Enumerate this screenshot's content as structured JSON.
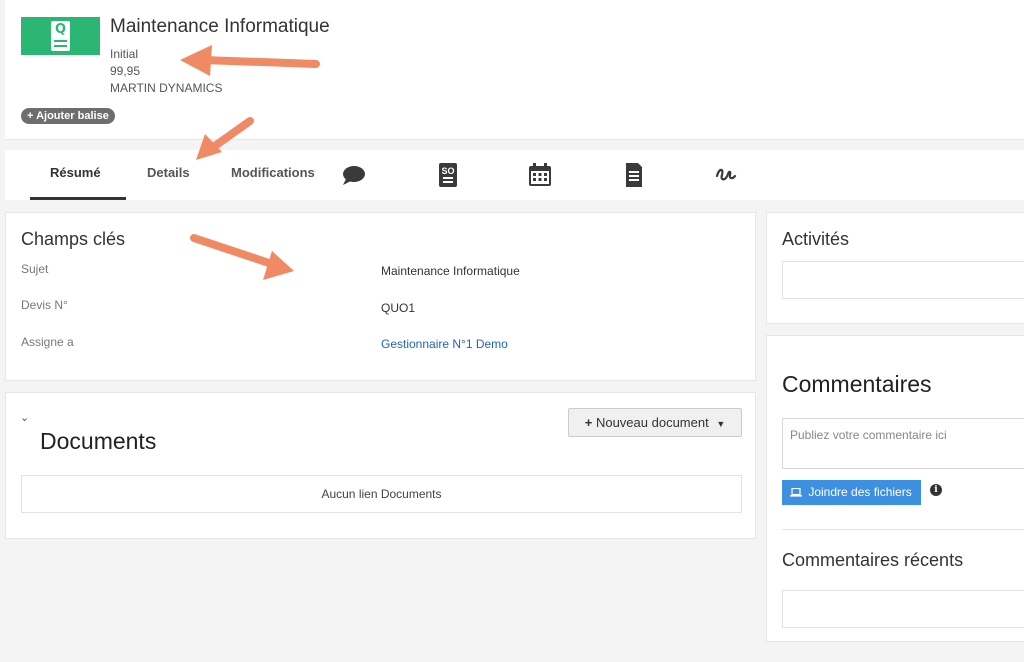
{
  "record": {
    "title": "Maintenance Informatique",
    "status": "Initial",
    "amount": "99,95",
    "company": "MARTIN DYNAMICS",
    "tag_button": "+ Ajouter balise"
  },
  "tabs": {
    "resume": "Résumé",
    "details": "Details",
    "modifications": "Modifications",
    "icons": [
      "chat-icon",
      "sales-order-icon",
      "calendar-icon",
      "document-icon",
      "signature-icon"
    ]
  },
  "key_fields": {
    "heading": "Champs clés",
    "rows": [
      {
        "label": "Sujet",
        "value": "Maintenance Informatique"
      },
      {
        "label": "Devis N°",
        "value": "QUO1"
      },
      {
        "label": "Assigne a",
        "value": "Gestionnaire N°1 Demo"
      }
    ]
  },
  "documents": {
    "heading": "Documents",
    "new_button": "Nouveau document",
    "empty_text": "Aucun lien Documents"
  },
  "activities": {
    "heading": "Activités"
  },
  "comments": {
    "heading": "Commentaires",
    "placeholder": "Publiez votre commentaire ici",
    "attach_button": "Joindre des fichiers",
    "recent_heading": "Commentaires récents"
  },
  "colors": {
    "brand_green": "#2bb673",
    "arrow": "#f08a64",
    "primary_button": "#3d8fe0",
    "link": "#2266bb"
  }
}
